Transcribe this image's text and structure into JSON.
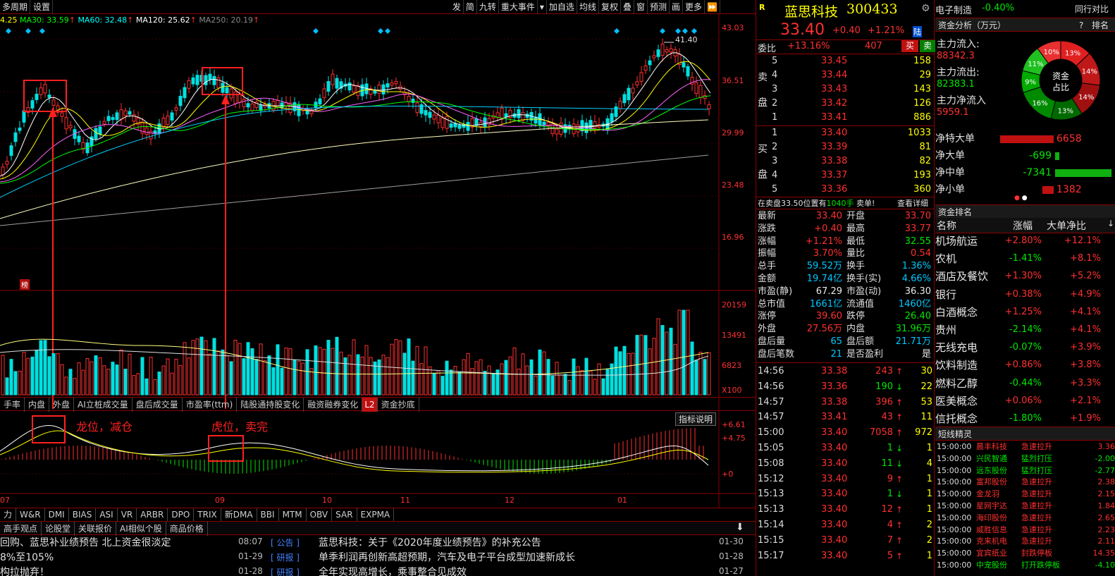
{
  "toolbar": {
    "period": "多周期",
    "settings": "设置",
    "right_buttons": [
      "发",
      "简",
      "九转",
      "重大事件",
      "▾",
      "加自选",
      "均线",
      "复权",
      "叠",
      "窗",
      "预测",
      "画",
      "更多",
      "⏩"
    ]
  },
  "ma_bar": {
    "ma5": "4.25",
    "ma30": "MA30: 33.59",
    "ma60": "MA60: 32.48",
    "ma120": "MA120: 25.62",
    "ma250": "MA250: 20.19",
    "colors": {
      "ma30": "#00ff00",
      "ma60": "#00ffff",
      "ma120": "#ffffff",
      "ma250": "#aaaaaa"
    }
  },
  "price_axis": [
    "43.03",
    "36.51",
    "29.99",
    "23.48",
    "16.96"
  ],
  "volume_axis": [
    "20159",
    "13491",
    "6823",
    "X100"
  ],
  "macd_axis": [
    "+6.61",
    "+4.75",
    "+0"
  ],
  "peak_label": "41.40",
  "small_badge": "榜",
  "x_axis": [
    "07",
    "09",
    "10",
    "11",
    "12",
    "01"
  ],
  "indicator_tabs": [
    "手率",
    "内盘",
    "外盘",
    "AI立桩成交量",
    "盘后成交量",
    "市盈率(ttm)",
    "陆股通持股变化",
    "融资融券变化",
    "L2",
    "资金抄底"
  ],
  "macd_annotations": {
    "dragon": "龙位，减仓",
    "tiger": "虎位，卖完"
  },
  "indicator_help": "指标说明",
  "bottom_tabs": [
    "力",
    "W&R",
    "DMI",
    "BIAS",
    "ASI",
    "VR",
    "ARBR",
    "DPO",
    "TRIX",
    "新DMA",
    "BBI",
    "MTM",
    "OBV",
    "SAR",
    "EXPMA"
  ],
  "news_tabs": [
    "高手观点",
    "论股堂",
    "关联报价",
    "AI相似个股",
    "商品价格"
  ],
  "news_left": [
    "回购、蓝思补业绩预告 北上资金很淡定",
    "8%至105%",
    "构拉抛弃！"
  ],
  "news_right": [
    {
      "time": "08:07",
      "tag": "公告",
      "title": "蓝思科技：关于《2020年度业绩预告》的补充公告",
      "date": "01-30"
    },
    {
      "time": "01-29",
      "tag": "研报",
      "title": "单季利润再创新高超预期，汽车及电子平台成型加速新成长",
      "date": "01-28"
    },
    {
      "time": "01-28",
      "tag": "研报",
      "title": "全年实现高增长，乘事整合见成效",
      "date": "01-27"
    }
  ],
  "stock": {
    "r_label": "R",
    "name": "蓝思科技",
    "code": "300433",
    "price": "33.40",
    "change": "+0.40",
    "change_pct": "+1.21%",
    "exchange": "陆",
    "weibi_label": "委比",
    "weibi": "+13.16%",
    "weicha": "407",
    "buy_btn": "买",
    "sell_btn": "卖"
  },
  "sell_levels": [
    {
      "lvl": "5",
      "price": "33.45",
      "vol": "158"
    },
    {
      "lvl": "4",
      "price": "33.44",
      "vol": "29"
    },
    {
      "lvl": "3",
      "price": "33.43",
      "vol": "143"
    },
    {
      "lvl": "2",
      "price": "33.42",
      "vol": "126"
    },
    {
      "lvl": "1",
      "price": "33.41",
      "vol": "886"
    }
  ],
  "buy_levels": [
    {
      "lvl": "1",
      "price": "33.40",
      "vol": "1033"
    },
    {
      "lvl": "2",
      "price": "33.39",
      "vol": "81"
    },
    {
      "lvl": "3",
      "price": "33.38",
      "vol": "82"
    },
    {
      "lvl": "4",
      "price": "33.37",
      "vol": "193"
    },
    {
      "lvl": "5",
      "price": "33.36",
      "vol": "360"
    }
  ],
  "sell_side_label": [
    "卖",
    "盘"
  ],
  "buy_side_label": [
    "买",
    "盘"
  ],
  "notice": {
    "text_a": "在卖盘33.50位置有",
    "qty": "1040手",
    "text_b": "卖单!",
    "detail": "查看详细"
  },
  "stats": [
    {
      "l1": "最新",
      "v1": "33.40",
      "c1": "red",
      "l2": "开盘",
      "v2": "33.70",
      "c2": "red"
    },
    {
      "l1": "涨跌",
      "v1": "+0.40",
      "c1": "red",
      "l2": "最高",
      "v2": "33.77",
      "c2": "red"
    },
    {
      "l1": "涨幅",
      "v1": "+1.21%",
      "c1": "red",
      "l2": "最低",
      "v2": "32.55",
      "c2": "green"
    },
    {
      "l1": "振幅",
      "v1": "3.70%",
      "c1": "red",
      "l2": "量比",
      "v2": "0.54",
      "c2": "red"
    },
    {
      "l1": "总手",
      "v1": "59.52万",
      "c1": "cyan",
      "l2": "换手",
      "v2": "1.36%",
      "c2": "cyan"
    },
    {
      "l1": "金额",
      "v1": "19.74亿",
      "c1": "cyan",
      "l2": "换手(实)",
      "v2": "4.66%",
      "c2": "cyan"
    },
    {
      "l1": "市盈(静)",
      "v1": "67.29",
      "c1": "white",
      "l2": "市盈(动)",
      "v2": "36.30",
      "c2": "white"
    },
    {
      "l1": "总市值",
      "v1": "1661亿",
      "c1": "cyan",
      "l2": "流通值",
      "v2": "1460亿",
      "c2": "cyan"
    },
    {
      "l1": "涨停",
      "v1": "39.60",
      "c1": "red",
      "l2": "跌停",
      "v2": "26.40",
      "c2": "green"
    },
    {
      "l1": "外盘",
      "v1": "27.56万",
      "c1": "red",
      "l2": "内盘",
      "v2": "31.96万",
      "c2": "green"
    },
    {
      "l1": "盘后量",
      "v1": "65",
      "c1": "cyan",
      "l2": "盘后额",
      "v2": "21.71万",
      "c2": "cyan"
    },
    {
      "l1": "盘后笔数",
      "v1": "21",
      "c1": "cyan",
      "l2": "是否盈利",
      "v2": "是",
      "c2": "white"
    }
  ],
  "ticks": [
    {
      "t": "14:56",
      "p": "33.38",
      "v": "243",
      "dir": "up",
      "n": "30"
    },
    {
      "t": "14:56",
      "p": "33.36",
      "v": "190",
      "dir": "down",
      "n": "22"
    },
    {
      "t": "14:57",
      "p": "33.38",
      "v": "396",
      "dir": "up",
      "n": "53"
    },
    {
      "t": "14:57",
      "p": "33.41",
      "v": "43",
      "dir": "up",
      "n": "11"
    },
    {
      "t": "15:00",
      "p": "33.40",
      "v": "7058",
      "dir": "up",
      "n": "972"
    },
    {
      "t": "15:05",
      "p": "33.40",
      "v": "1",
      "dir": "down",
      "n": "1"
    },
    {
      "t": "15:08",
      "p": "33.40",
      "v": "11",
      "dir": "down",
      "n": "4"
    },
    {
      "t": "15:12",
      "p": "33.40",
      "v": "9",
      "dir": "up",
      "n": "1"
    },
    {
      "t": "15:13",
      "p": "33.40",
      "v": "1",
      "dir": "down",
      "n": "1"
    },
    {
      "t": "15:13",
      "p": "33.40",
      "v": "12",
      "dir": "up",
      "n": "1"
    },
    {
      "t": "15:14",
      "p": "33.40",
      "v": "4",
      "dir": "up",
      "n": "2"
    },
    {
      "t": "15:15",
      "p": "33.40",
      "v": "7",
      "dir": "up",
      "n": "2"
    },
    {
      "t": "15:17",
      "p": "33.40",
      "v": "5",
      "dir": "up",
      "n": "1"
    }
  ],
  "far_right": {
    "sector": "电子制造",
    "sector_pct": "-0.40%",
    "compare": "同行对比",
    "fund_title": "资金分析（万元）",
    "fund_q": "?",
    "fund_sort": "排名",
    "inflow_label": "主力流入:",
    "inflow": "88342.3",
    "outflow_label": "主力流出:",
    "outflow": "82383.1",
    "net_label": "主力净流入",
    "net": "5959.1",
    "pie_center": [
      "资金",
      "占比"
    ],
    "pie_slices": [
      {
        "label": "13%",
        "pct": 13,
        "color": "#e02020"
      },
      {
        "label": "14%",
        "pct": 14,
        "color": "#c01818"
      },
      {
        "label": "14%",
        "pct": 14,
        "color": "#a01010"
      },
      {
        "label": "13%",
        "pct": 13,
        "color": "#006a00"
      },
      {
        "label": "16%",
        "pct": 16,
        "color": "#008a00"
      },
      {
        "label": "9%",
        "pct": 9,
        "color": "#00aa00"
      },
      {
        "label": "11%",
        "pct": 11,
        "color": "#20c020"
      },
      {
        "label": "10%",
        "pct": 10,
        "color": "#e83030"
      }
    ],
    "net_flows": [
      {
        "label": "净特大单",
        "value": "6658",
        "sign": 1,
        "frac": 0.95
      },
      {
        "label": "净大单",
        "value": "-699",
        "sign": -1,
        "frac": 0.08
      },
      {
        "label": "净中单",
        "value": "-7341",
        "sign": -1,
        "frac": 1.0
      },
      {
        "label": "净小单",
        "value": "1382",
        "sign": 1,
        "frac": 0.2
      }
    ],
    "rank_title": "资金排名",
    "rank_headers": [
      "名称",
      "涨幅",
      "大单净比"
    ],
    "rank_rows": [
      {
        "name": "机场航运",
        "pct": "+2.80%",
        "ratio": "+12.1%"
      },
      {
        "name": "农机",
        "pct": "-1.41%",
        "ratio": "+8.1%"
      },
      {
        "name": "酒店及餐饮",
        "pct": "+1.30%",
        "ratio": "+5.2%"
      },
      {
        "name": "银行",
        "pct": "+0.38%",
        "ratio": "+4.9%"
      },
      {
        "name": "白酒概念",
        "pct": "+1.25%",
        "ratio": "+4.1%"
      },
      {
        "name": "贵州",
        "pct": "-2.14%",
        "ratio": "+4.1%"
      },
      {
        "name": "无线充电",
        "pct": "-0.07%",
        "ratio": "+3.9%"
      },
      {
        "name": "饮料制造",
        "pct": "+0.86%",
        "ratio": "+3.8%"
      },
      {
        "name": "燃料乙醇",
        "pct": "-0.44%",
        "ratio": "+3.3%"
      },
      {
        "name": "医美概念",
        "pct": "+0.06%",
        "ratio": "+2.1%"
      },
      {
        "name": "信托概念",
        "pct": "-1.80%",
        "ratio": "+1.9%"
      }
    ],
    "sprite_title": "短线精灵",
    "sprite_rows": [
      {
        "t": "15:00:00",
        "name": "晨丰科技",
        "act": "急速拉升",
        "v": "3.36",
        "up": true
      },
      {
        "t": "15:00:00",
        "name": "兴民智通",
        "act": "猛烈打压",
        "v": "-2.00",
        "up": false
      },
      {
        "t": "15:00:00",
        "name": "远东股份",
        "act": "猛烈打压",
        "v": "-2.77",
        "up": false
      },
      {
        "t": "15:00:00",
        "name": "富邦股份",
        "act": "急速拉升",
        "v": "2.38",
        "up": true
      },
      {
        "t": "15:00:00",
        "name": "金龙羽",
        "act": "急速拉升",
        "v": "2.15",
        "up": true
      },
      {
        "t": "15:00:00",
        "name": "星网宇达",
        "act": "急速拉升",
        "v": "1.84",
        "up": true
      },
      {
        "t": "15:00:00",
        "name": "海印股份",
        "act": "急速拉升",
        "v": "2.65",
        "up": true
      },
      {
        "t": "15:00:00",
        "name": "威胜信息",
        "act": "急速拉升",
        "v": "2.23",
        "up": true
      },
      {
        "t": "15:00:00",
        "name": "克来机电",
        "act": "急速拉升",
        "v": "2.11",
        "up": true
      },
      {
        "t": "15:00:00",
        "name": "宜宾纸业",
        "act": "封跌停板",
        "v": "14.35",
        "up": true
      },
      {
        "t": "15:00:00",
        "name": "中宠股份",
        "act": "打开跌停板",
        "v": "-4.10",
        "up": false
      }
    ]
  }
}
